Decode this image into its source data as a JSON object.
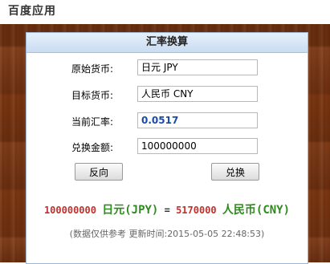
{
  "app": {
    "title": "百度应用"
  },
  "panel": {
    "title": "汇率换算"
  },
  "form": {
    "source_label": "原始货币:",
    "source_value": "日元 JPY",
    "target_label": "目标货币:",
    "target_value": "人民币 CNY",
    "rate_label": "当前汇率:",
    "rate_value": "0.0517",
    "amount_label": "兑换金额:",
    "amount_value": "100000000"
  },
  "buttons": {
    "reverse": "反向",
    "convert": "兑换"
  },
  "result": {
    "from_amount": "100000000",
    "from_currency": "日元(JPY)",
    "equals": "=",
    "to_amount": "5170000",
    "to_currency": "人民币(CNY)"
  },
  "note": {
    "prefix": "(数据仅供参考",
    "updated_label": "更新时间:",
    "updated_time": "2015-05-05 22:48:53)"
  },
  "colors": {
    "wood_background": "#7a3510",
    "panel_header": "#c9dcf2",
    "panel_border": "#9bb6d6",
    "amount_red": "#c0302c",
    "currency_green": "#2f8a1f",
    "rate_blue": "#1a4aa8"
  }
}
